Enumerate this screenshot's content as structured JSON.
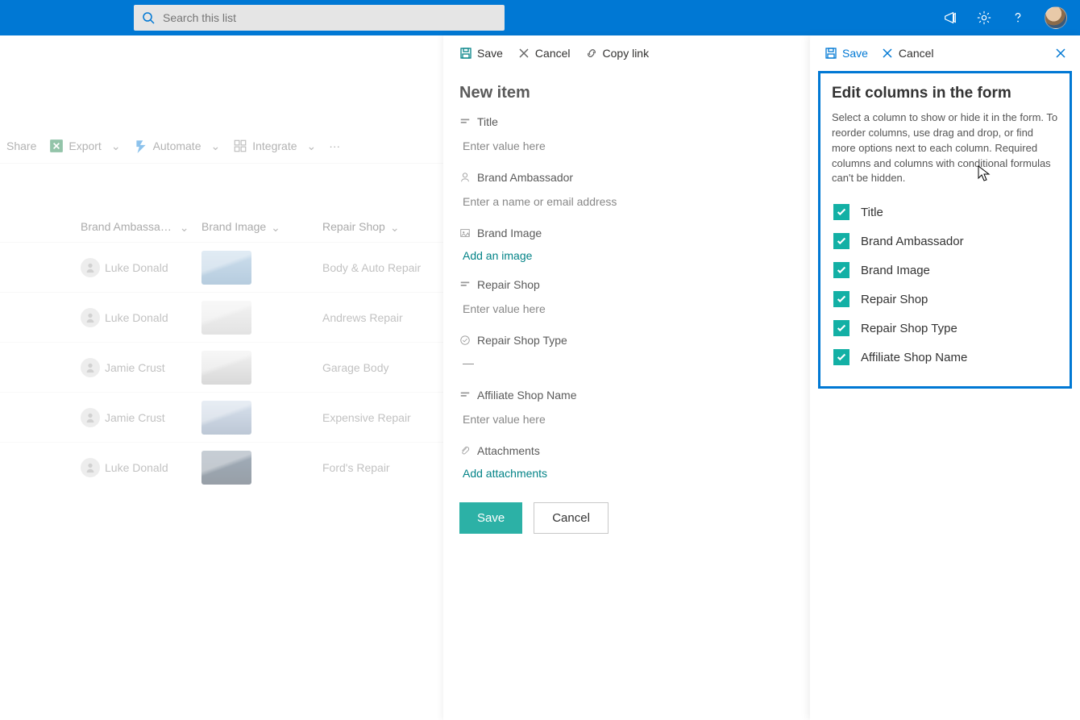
{
  "topbar": {
    "search_placeholder": "Search this list"
  },
  "list": {
    "toolbar": {
      "share": "Share",
      "export": "Export",
      "automate": "Automate",
      "integrate": "Integrate"
    },
    "columns": {
      "ambassador": "Brand Ambassa… ",
      "image": "Brand Image",
      "shop": "Repair Shop"
    },
    "rows": [
      {
        "ambassador": "Luke Donald",
        "thumb": "car1",
        "shop": "Body & Auto Repair"
      },
      {
        "ambassador": "Luke Donald",
        "thumb": "car2",
        "shop": "Andrews Repair"
      },
      {
        "ambassador": "Jamie Crust",
        "thumb": "car3",
        "shop": "Garage Body"
      },
      {
        "ambassador": "Jamie Crust",
        "thumb": "car4",
        "shop": "Expensive Repair"
      },
      {
        "ambassador": "Luke Donald",
        "thumb": "car5",
        "shop": "Ford's Repair"
      }
    ]
  },
  "newItem": {
    "cmd_save": "Save",
    "cmd_cancel": "Cancel",
    "cmd_copylink": "Copy link",
    "title": "New item",
    "fields": {
      "title_label": "Title",
      "title_ph": "Enter value here",
      "ambassador_label": "Brand Ambassador",
      "ambassador_ph": "Enter a name or email address",
      "image_label": "Brand Image",
      "image_link": "Add an image",
      "shop_label": "Repair Shop",
      "shop_ph": "Enter value here",
      "shoptype_label": "Repair Shop Type",
      "shoptype_val": "—",
      "affiliate_label": "Affiliate Shop Name",
      "affiliate_ph": "Enter value here",
      "attach_label": "Attachments",
      "attach_link": "Add attachments"
    },
    "btn_save": "Save",
    "btn_cancel": "Cancel"
  },
  "editCols": {
    "cmd_save": "Save",
    "cmd_cancel": "Cancel",
    "heading": "Edit columns in the form",
    "desc": "Select a column to show or hide it in the form. To reorder columns, use drag and drop, or find more options next to each column. Required columns and columns with conditional formulas can't be hidden.",
    "items": [
      "Title",
      "Brand Ambassador",
      "Brand Image",
      "Repair Shop",
      "Repair Shop Type",
      "Affiliate Shop Name"
    ]
  }
}
